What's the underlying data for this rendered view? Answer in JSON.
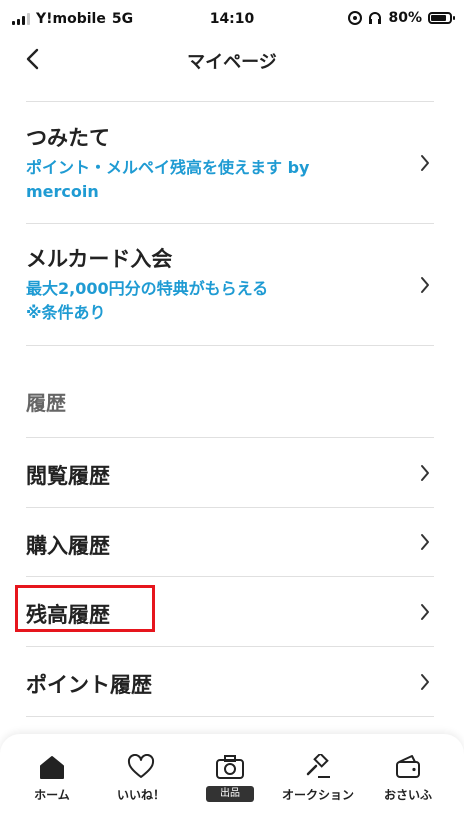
{
  "status_bar": {
    "carrier": "Y!mobile",
    "network": "5G",
    "time": "14:10",
    "battery": "80%",
    "battery_level": 0.8
  },
  "nav": {
    "title": "マイページ",
    "back_icon": "chevron-left-icon"
  },
  "menu": {
    "tsumitate": {
      "title": "つみたて",
      "subtitle_line1": "ポイント・メルペイ残高を使えます by",
      "subtitle_line2": "mercoin"
    },
    "mercard": {
      "title": "メルカード入会",
      "subtitle_line1": "最大2,000円分の特典がもらえる",
      "subtitle_line2": "※条件あり"
    },
    "history_section": "履歴",
    "history_items": [
      "閲覧履歴",
      "購入履歴",
      "残高履歴",
      "ポイント履歴"
    ]
  },
  "tab_bar": {
    "home": "ホーム",
    "likes": "いいね！",
    "sell": "出品",
    "auction": "オークション",
    "wallet": "おさいふ"
  },
  "colors": {
    "accent_blue": "#1f9bd3",
    "highlight_red": "#e6151d"
  }
}
